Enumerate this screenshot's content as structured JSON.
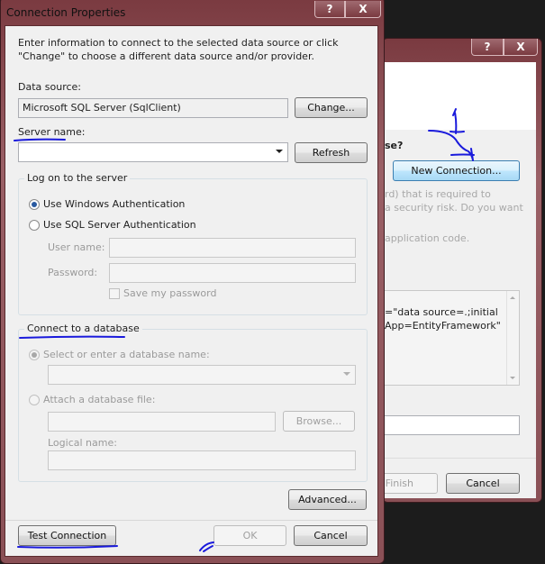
{
  "back_dialog": {
    "help_label": "?",
    "close_label": "X",
    "question_fragment": "se?",
    "new_connection_label": "New Connection...",
    "text_line1": "rd) that is required to",
    "text_line2": "a security risk. Do you want",
    "text_line3": "application code.",
    "connstr_line1": "=\"data source=.;initial",
    "connstr_line2": "App=EntityFramework\"",
    "finish_label": "Finish",
    "cancel_label": "Cancel"
  },
  "dialog": {
    "title": "Connection Properties",
    "help_label": "?",
    "close_label": "X",
    "intro": "Enter information to connect to the selected data source or click \"Change\" to choose a different data source and/or provider.",
    "data_source_label": "Data source:",
    "data_source_value": "Microsoft SQL Server (SqlClient)",
    "change_label": "Change...",
    "server_name_label": "Server name:",
    "server_name_value": "",
    "refresh_label": "Refresh",
    "logon_group": {
      "title": "Log on to the server",
      "windows_auth": "Use Windows Authentication",
      "sql_auth": "Use SQL Server Authentication",
      "user_name_label": "User name:",
      "password_label": "Password:",
      "save_password": "Save my password"
    },
    "db_group": {
      "title": "Connect to a database",
      "select_db": "Select or enter a database name:",
      "attach_file": "Attach a database file:",
      "browse_label": "Browse...",
      "logical_name_label": "Logical name:"
    },
    "advanced_label": "Advanced...",
    "test_connection_label": "Test Connection",
    "ok_label": "OK",
    "cancel_label": "Cancel"
  },
  "annotations": {
    "number": "1",
    "color": "#1a1adc"
  }
}
